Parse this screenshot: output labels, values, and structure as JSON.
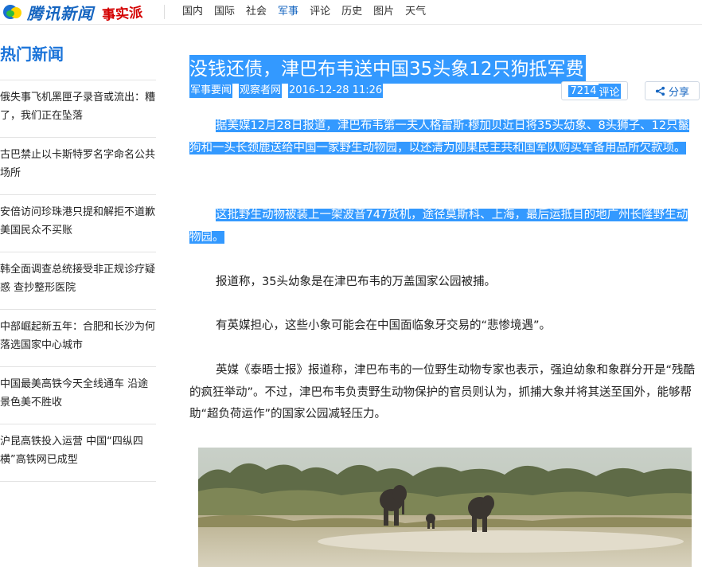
{
  "header": {
    "logo_text": "腾讯新闻",
    "logo_sub": "事实派",
    "nav": [
      "国内",
      "国际",
      "社会",
      "军事",
      "评论",
      "历史",
      "图片",
      "天气"
    ],
    "active_nav": "军事"
  },
  "sidebar": {
    "title": "热门新闻",
    "items": [
      "俄失事飞机黑匣子录音或流出：糟了，我们正在坠落",
      "古巴禁止以卡斯特罗名字命名公共场所",
      "安倍访问珍珠港只提和解拒不道歉 美国民众不买账",
      "韩全面调查总统接受非正规诊疗疑惑 查抄整形医院",
      "中部崛起新五年：合肥和长沙为何落选国家中心城市",
      "中国最美高铁今天全线通车 沿途景色美不胜收",
      "沪昆高铁投入运营 中国“四纵四横”高铁网已成型"
    ]
  },
  "article": {
    "title": "没钱还债，津巴布韦送中国35头象12只狗抵军费",
    "category": "军事要闻",
    "source": "观察者网",
    "datetime": "2016-12-28 11:26",
    "comment_count": "7214",
    "comment_label": "评论",
    "share_label": "分享",
    "paragraphs": [
      "据美媒12月28日报道，津巴布韦第一夫人格雷斯·穆加贝近日将35头幼象、8头狮子、12只鬣狗和一头长颈鹿送给中国一家野生动物园，以还清为刚果民主共和国军队购买军备用品所欠款项。",
      "这批野生动物被装上一架波音747货机，途径莫斯科、上海，最后运抵目的地广州长隆野生动物园。",
      "报道称，35头幼象是在津巴布韦的万盖国家公园被捕。",
      "有英媒担心，这些小象可能会在中国面临象牙交易的“悲惨境遇”。",
      "英媒《泰晤士报》报道称，津巴布韦的一位野生动物专家也表示，强迫幼象和象群分开是“残酷的疯狂举动”。不过，津巴布韦负责野生动物保护的官员则认为，抓捕大象并将其送至国外，能够帮助“超负荷运作”的国家公园减轻压力。"
    ],
    "selected_paragraphs": [
      0,
      1
    ],
    "photo_subject": "elephants-in-savanna"
  },
  "colors": {
    "brand_blue": "#1565c0",
    "selection": "#3399ff",
    "sidebar_title": "#1a73d9",
    "logo_red": "#d40000"
  }
}
